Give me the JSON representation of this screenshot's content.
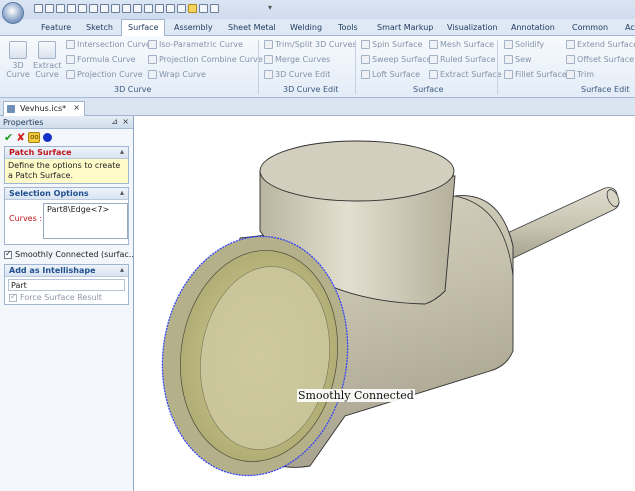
{
  "ribbon_tabs": {
    "feature": "Feature",
    "sketch": "Sketch",
    "surface": "Surface",
    "assembly": "Assembly",
    "sheet_metal": "Sheet Metal",
    "welding": "Welding",
    "tools": "Tools",
    "smart_markup": "Smart Markup",
    "visualization": "Visualization",
    "annotation": "Annotation",
    "common": "Common",
    "overflow": "Ac"
  },
  "groups": {
    "curve3d": {
      "label": "3D Curve",
      "curve_3d": "3D\nCurve",
      "extract_curve": "Extract\nCurve",
      "intersection_curve": "Intersection Curve",
      "formula_curve": "Formula Curve",
      "projection_curve": "Projection Curve",
      "iso_parametric_curve": "Iso-Parametric Curve",
      "projection_combine_curve": "Projection Combine Curve",
      "wrap_curve": "Wrap Curve"
    },
    "curve_edit": {
      "label": "3D Curve Edit",
      "trim_split": "Trim/Split 3D Curves",
      "merge_curves": "Merge Curves",
      "curve_edit": "3D Curve Edit"
    },
    "surface": {
      "label": "Surface",
      "spin_surface": "Spin Surface",
      "sweep_surface": "Sweep Surface",
      "loft_surface": "Loft Surface",
      "mesh_surface": "Mesh Surface",
      "ruled_surface": "Ruled Surface",
      "extract_surface": "Extract Surface"
    },
    "surface_edit": {
      "label": "Surface Edit",
      "solidify": "Solidify",
      "sew": "Sew",
      "fillet_surface": "Fillet Surface",
      "extend_surface": "Extend Surface",
      "offset_surface": "Offset Surface",
      "trim": "Trim"
    }
  },
  "document_tab": {
    "name": "Vevhus.ics*",
    "close": "×"
  },
  "properties": {
    "title": "Properties",
    "pin": "⊿",
    "close": "×",
    "patch_surface": {
      "title": "Patch Surface",
      "description": "Define the options to create a Patch Surface."
    },
    "selection_options": {
      "title": "Selection Options",
      "curves_label": "Curves :",
      "curves_value": "Part8\\Edge<7>",
      "smoothly_connected_label": "Smoothly Connected (surfac...",
      "smoothly_connected_checked": true
    },
    "add_as_intellishape": {
      "title": "Add as Intellishape",
      "part_value": "Part",
      "force_surface_label": "Force Surface Result",
      "force_surface_checked": true,
      "force_surface_enabled": false
    }
  },
  "viewport": {
    "annotation": "Smoothly Connected"
  },
  "colors": {
    "ribbon_bg": "#e3ecf7",
    "panel_accent": "#1f4f8f",
    "required": "#c0141c",
    "model_body": "#c9c5b3",
    "selected_edge": "#2a3cff"
  }
}
